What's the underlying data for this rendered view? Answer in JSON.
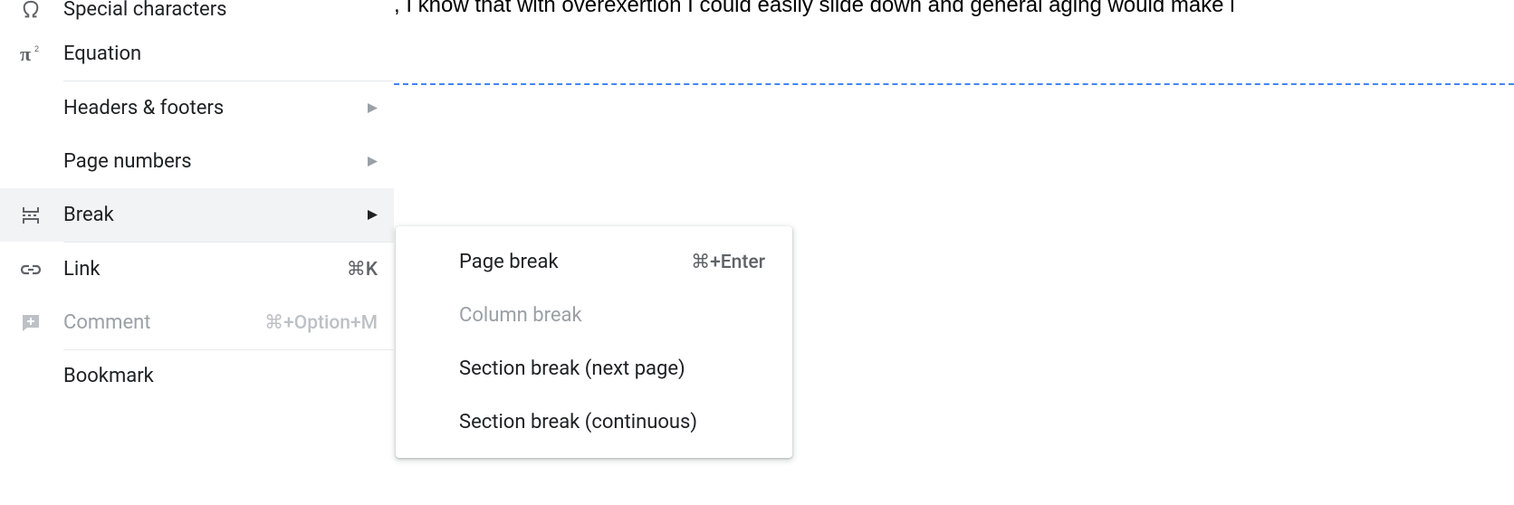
{
  "document": {
    "visible_text": ", I know that with overexertion I could easily slide down and general aging would make i"
  },
  "menu": {
    "special_characters": {
      "label": "Special characters"
    },
    "equation": {
      "label": "Equation"
    },
    "headers_footers": {
      "label": "Headers & footers"
    },
    "page_numbers": {
      "label": "Page numbers"
    },
    "break": {
      "label": "Break"
    },
    "link": {
      "label": "Link",
      "shortcut": "⌘K"
    },
    "comment": {
      "label": "Comment",
      "shortcut": "⌘+Option+M"
    },
    "bookmark": {
      "label": "Bookmark"
    }
  },
  "submenu": {
    "page_break": {
      "label": "Page break",
      "shortcut": "⌘+Enter"
    },
    "column_break": {
      "label": "Column break"
    },
    "section_next": {
      "label": "Section break (next page)"
    },
    "section_continuous": {
      "label": "Section break (continuous)"
    }
  }
}
